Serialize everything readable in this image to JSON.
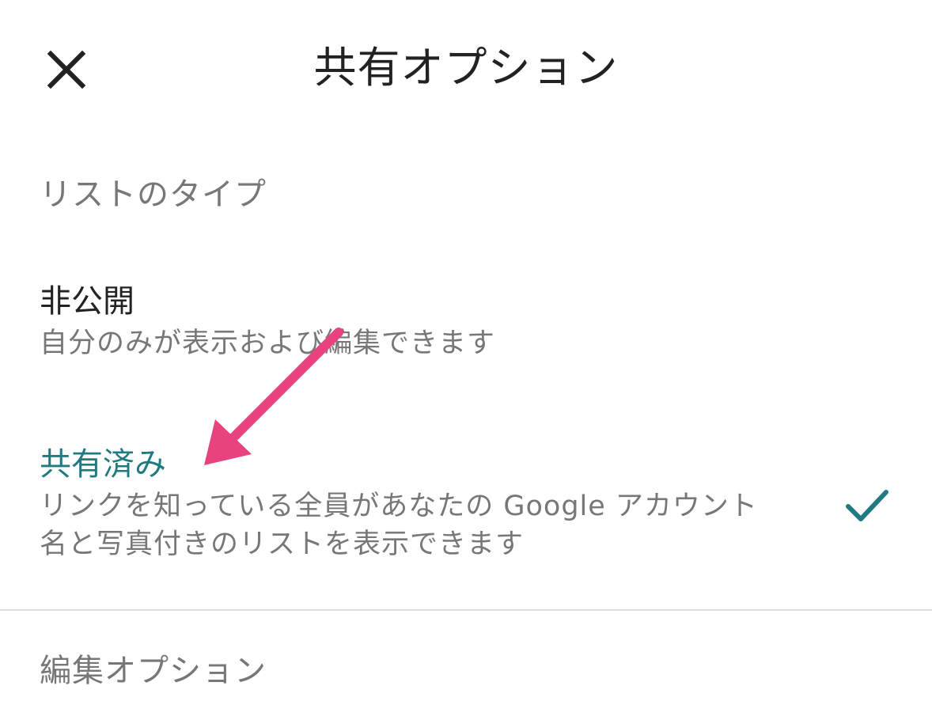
{
  "header": {
    "title": "共有オプション",
    "close_icon": "close-icon"
  },
  "list_type": {
    "section_label": "リストのタイプ",
    "options": [
      {
        "title": "非公開",
        "description": "自分のみが表示および編集できます",
        "selected": false
      },
      {
        "title": "共有済み",
        "description_line1": "リンクを知っている全員があなたの Google アカウント",
        "description_line2": "名と写真付きのリストを表示できます",
        "selected": true,
        "check_icon": "checkmark-icon"
      }
    ]
  },
  "edit_options": {
    "section_label": "編集オプション"
  },
  "colors": {
    "accent": "#1f7b80",
    "annotation_arrow": "#e8437e",
    "secondary_text": "#777777"
  }
}
